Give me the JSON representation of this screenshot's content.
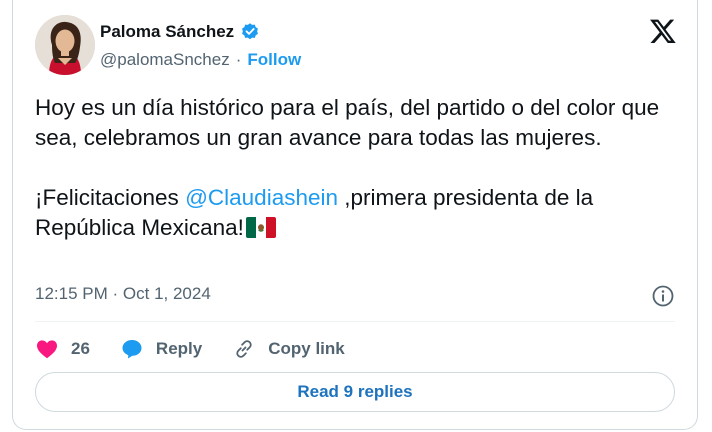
{
  "author": {
    "name": "Paloma Sánchez",
    "handle": "@palomaSnchez",
    "separator": "·",
    "follow_label": "Follow"
  },
  "tweet": {
    "text_part1": "Hoy es un día histórico para el país, del partido o del color que sea, celebramos un gran avance para todas las mujeres.\n\n¡Felicitaciones ",
    "mention": "@Claudiashein",
    "text_part2": " ,primera presidenta de la República Mexicana!"
  },
  "meta": {
    "time": "12:15 PM",
    "separator": "·",
    "date": "Oct 1, 2024"
  },
  "actions": {
    "likes_count": "26",
    "reply_label": "Reply",
    "copy_link_label": "Copy link"
  },
  "read_replies_label": "Read 9 replies",
  "colors": {
    "accent": "#1d9bf0",
    "like": "#f91880",
    "text": "#0f1419",
    "secondary": "#536471"
  },
  "icons": [
    "verified-badge-icon",
    "x-logo-icon",
    "mexico-flag-icon",
    "info-icon",
    "heart-icon",
    "reply-bubble-icon",
    "link-icon"
  ]
}
